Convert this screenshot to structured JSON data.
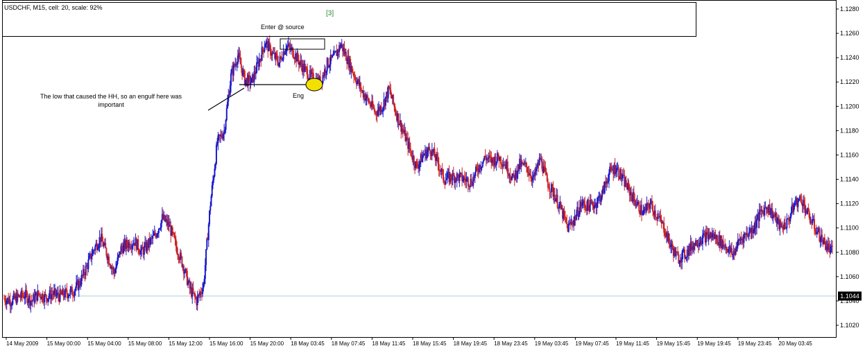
{
  "header": {
    "symbol_info": "USDCHF, M15, cell: 20, scale: 92%"
  },
  "annotations": {
    "wave": "[3]",
    "entry": "Enter @ source",
    "note": "The low that caused the HH, so an engulf here was important",
    "engulf": "Eng"
  },
  "colors": {
    "bull": "#1a1acc",
    "bear": "#cc2222",
    "level_line": "#a8cfd4",
    "highlight": "#f4e000"
  },
  "current_price_label": "1.1044",
  "chart_data": {
    "type": "candlestick",
    "symbol": "USDCHF",
    "timeframe": "M15",
    "ylim": [
      1.101,
      1.129
    ],
    "yticks": [
      "1.1280",
      "1.1260",
      "1.1240",
      "1.1220",
      "1.1200",
      "1.1180",
      "1.1160",
      "1.1140",
      "1.1120",
      "1.1100",
      "1.1080",
      "1.1060",
      "1.1040",
      "1.1020"
    ],
    "xticks": [
      "14 May 2009",
      "15 May 00:00",
      "15 May 04:00",
      "15 May 08:00",
      "15 May 12:00",
      "15 May 16:00",
      "15 May 20:00",
      "18 May 03:45",
      "18 May 07:45",
      "18 May 11:45",
      "18 May 15:45",
      "18 May 19:45",
      "18 May 23:45",
      "19 May 03:45",
      "19 May 07:45",
      "19 May 11:45",
      "19 May 15:45",
      "19 May 19:45",
      "19 May 23:45",
      "20 May 03:45"
    ],
    "current_price": 1.1044,
    "close_path": [
      [
        0,
        1.1042
      ],
      [
        2,
        1.104
      ],
      [
        4,
        1.1043
      ],
      [
        6,
        1.1045
      ],
      [
        8,
        1.104
      ],
      [
        10,
        1.1046
      ],
      [
        12,
        1.1043
      ],
      [
        14,
        1.1046
      ],
      [
        16,
        1.1044
      ],
      [
        18,
        1.1046
      ],
      [
        20,
        1.1048
      ],
      [
        22,
        1.1055
      ],
      [
        24,
        1.1068
      ],
      [
        26,
        1.1082
      ],
      [
        28,
        1.1092
      ],
      [
        30,
        1.1078
      ],
      [
        32,
        1.1063
      ],
      [
        34,
        1.1083
      ],
      [
        36,
        1.1087
      ],
      [
        38,
        1.1089
      ],
      [
        40,
        1.108
      ],
      [
        42,
        1.1087
      ],
      [
        44,
        1.1094
      ],
      [
        46,
        1.1108
      ],
      [
        48,
        1.1102
      ],
      [
        50,
        1.1085
      ],
      [
        52,
        1.107
      ],
      [
        54,
        1.105
      ],
      [
        56,
        1.104
      ],
      [
        58,
        1.1053
      ],
      [
        60,
        1.112
      ],
      [
        62,
        1.117
      ],
      [
        64,
        1.118
      ],
      [
        66,
        1.1225
      ],
      [
        68,
        1.1242
      ],
      [
        70,
        1.1222
      ],
      [
        72,
        1.122
      ],
      [
        74,
        1.1236
      ],
      [
        76,
        1.1253
      ],
      [
        78,
        1.1243
      ],
      [
        80,
        1.1236
      ],
      [
        82,
        1.125
      ],
      [
        84,
        1.1245
      ],
      [
        86,
        1.1236
      ],
      [
        88,
        1.1228
      ],
      [
        90,
        1.1222
      ],
      [
        92,
        1.122
      ],
      [
        94,
        1.1235
      ],
      [
        96,
        1.124
      ],
      [
        98,
        1.1251
      ],
      [
        100,
        1.1238
      ],
      [
        102,
        1.1225
      ],
      [
        104,
        1.1213
      ],
      [
        106,
        1.1204
      ],
      [
        108,
        1.1195
      ],
      [
        110,
        1.12
      ],
      [
        112,
        1.1214
      ],
      [
        114,
        1.1195
      ],
      [
        116,
        1.118
      ],
      [
        118,
        1.1165
      ],
      [
        120,
        1.115
      ],
      [
        122,
        1.116
      ],
      [
        124,
        1.1165
      ],
      [
        126,
        1.1155
      ],
      [
        128,
        1.114
      ],
      [
        130,
        1.1142
      ],
      [
        132,
        1.1142
      ],
      [
        134,
        1.114
      ],
      [
        136,
        1.1138
      ],
      [
        138,
        1.115
      ],
      [
        140,
        1.1158
      ],
      [
        142,
        1.1155
      ],
      [
        144,
        1.1158
      ],
      [
        146,
        1.1152
      ],
      [
        148,
        1.114
      ],
      [
        150,
        1.1152
      ],
      [
        152,
        1.115
      ],
      [
        154,
        1.114
      ],
      [
        156,
        1.1157
      ],
      [
        158,
        1.1138
      ],
      [
        160,
        1.1128
      ],
      [
        162,
        1.1115
      ],
      [
        164,
        1.11
      ],
      [
        166,
        1.1108
      ],
      [
        168,
        1.112
      ],
      [
        170,
        1.1118
      ],
      [
        172,
        1.112
      ],
      [
        174,
        1.1128
      ],
      [
        176,
        1.1145
      ],
      [
        178,
        1.115
      ],
      [
        180,
        1.114
      ],
      [
        182,
        1.113
      ],
      [
        184,
        1.112
      ],
      [
        186,
        1.1112
      ],
      [
        188,
        1.112
      ],
      [
        190,
        1.111
      ],
      [
        192,
        1.11
      ],
      [
        194,
        1.1085
      ],
      [
        196,
        1.1075
      ],
      [
        198,
        1.1078
      ],
      [
        200,
        1.1085
      ],
      [
        202,
        1.109
      ],
      [
        204,
        1.1093
      ],
      [
        206,
        1.1094
      ],
      [
        208,
        1.109
      ],
      [
        210,
        1.1085
      ],
      [
        212,
        1.1078
      ],
      [
        214,
        1.109
      ],
      [
        216,
        1.1095
      ],
      [
        218,
        1.11
      ],
      [
        220,
        1.1112
      ],
      [
        222,
        1.1118
      ],
      [
        224,
        1.111
      ],
      [
        226,
        1.11
      ],
      [
        228,
        1.1105
      ],
      [
        230,
        1.112
      ],
      [
        232,
        1.1124
      ],
      [
        234,
        1.111
      ],
      [
        236,
        1.11
      ],
      [
        238,
        1.109
      ],
      [
        240,
        1.1083
      ],
      [
        241,
        1.108
      ]
    ]
  }
}
